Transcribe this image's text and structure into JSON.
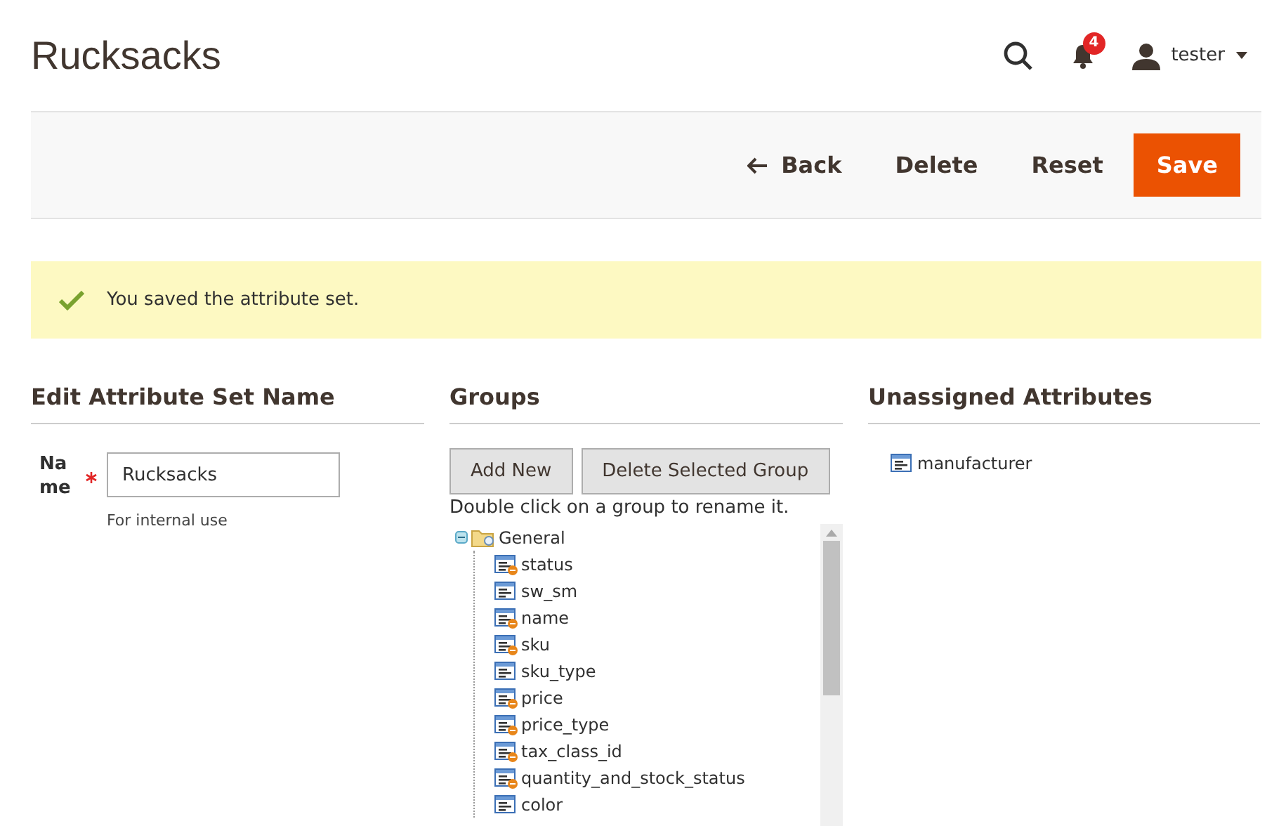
{
  "page_title": "Rucksacks",
  "header": {
    "notification_count": "4",
    "user": "tester"
  },
  "actions": [
    {
      "label": "Back",
      "kind": "back"
    },
    {
      "label": "Delete",
      "kind": "plain"
    },
    {
      "label": "Reset",
      "kind": "plain"
    },
    {
      "label": "Save",
      "kind": "primary"
    }
  ],
  "message": "You saved the attribute set.",
  "edit_section": {
    "title": "Edit Attribute Set Name",
    "field_label": "Name",
    "required": true,
    "value": "Rucksacks",
    "note": "For internal use"
  },
  "groups": {
    "title": "Groups",
    "buttons": [
      "Add New",
      "Delete Selected Group"
    ],
    "hint": "Double click on a group to rename it.",
    "tree": [
      {
        "label": "General",
        "expanded": true,
        "children": [
          {
            "label": "status",
            "kind": "system"
          },
          {
            "label": "sw_sm",
            "kind": "user"
          },
          {
            "label": "name",
            "kind": "system"
          },
          {
            "label": "sku",
            "kind": "system"
          },
          {
            "label": "sku_type",
            "kind": "user"
          },
          {
            "label": "price",
            "kind": "system"
          },
          {
            "label": "price_type",
            "kind": "system"
          },
          {
            "label": "tax_class_id",
            "kind": "system"
          },
          {
            "label": "quantity_and_stock_status",
            "kind": "system"
          },
          {
            "label": "color",
            "kind": "user"
          }
        ]
      }
    ]
  },
  "unassigned": {
    "title": "Unassigned Attributes",
    "items": [
      {
        "label": "manufacturer",
        "kind": "user"
      }
    ]
  }
}
